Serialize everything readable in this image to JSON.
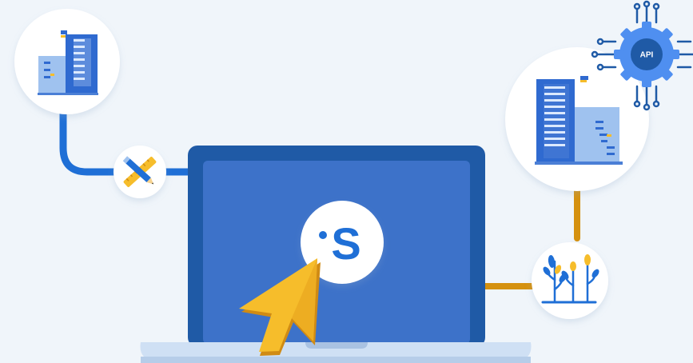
{
  "logo": {
    "letter": "S"
  },
  "api_badge": {
    "label": "API"
  },
  "colors": {
    "background": "#f0f5fa",
    "laptop_frame": "#1f5aa6",
    "laptop_screen": "#3d72c9",
    "laptop_base": "#cfe0f4",
    "connector_blue": "#1f6fd6",
    "connector_orange": "#d5910f",
    "cursor_yellow": "#f6bd2b",
    "cursor_shadow": "#d08b14",
    "gear_blue": "#4f8ff0"
  },
  "icons": {
    "left_building": "office-building-icon",
    "right_building": "office-building-icon",
    "tools": "pencil-ruler-icon",
    "plants": "plants-growth-icon",
    "api": "api-gear-icon",
    "cursor": "mouse-cursor-icon"
  }
}
